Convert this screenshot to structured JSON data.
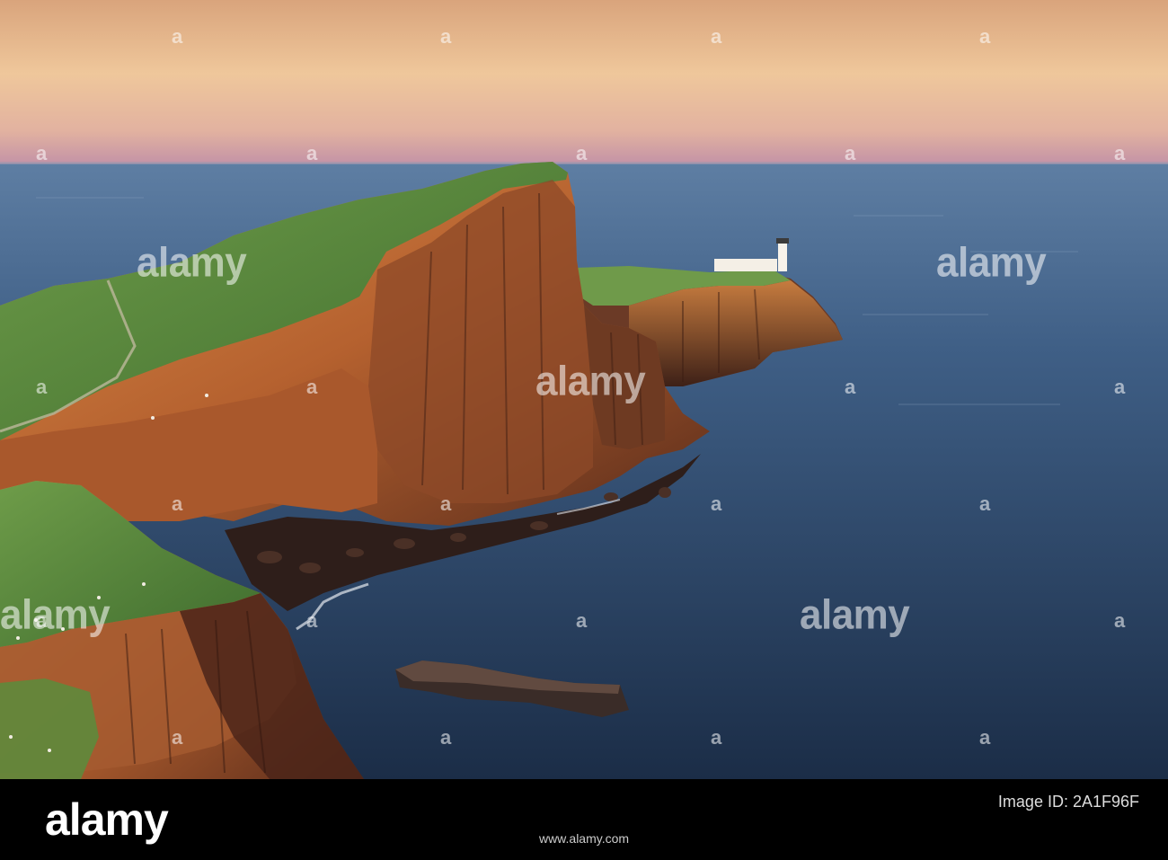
{
  "photo": {
    "subject": "Neist Point lighthouse cliffs at sunset",
    "colors": {
      "sky_top": "#f2b98a",
      "sky_mid": "#e9c49c",
      "sky_horizon": "#c99aa3",
      "sea_far": "#4f6f95",
      "sea_near": "#1f3450",
      "cliff_lit": "#c8743a",
      "cliff_shadow": "#4a2418",
      "grass": "#5a8a3a"
    }
  },
  "watermarks": {
    "text": "alamy",
    "letter": "a"
  },
  "footer": {
    "logo": "alamy",
    "image_id_label": "Image ID: 2A1F96F",
    "image_id": "2A1F96F",
    "url": "www.alamy.com"
  }
}
